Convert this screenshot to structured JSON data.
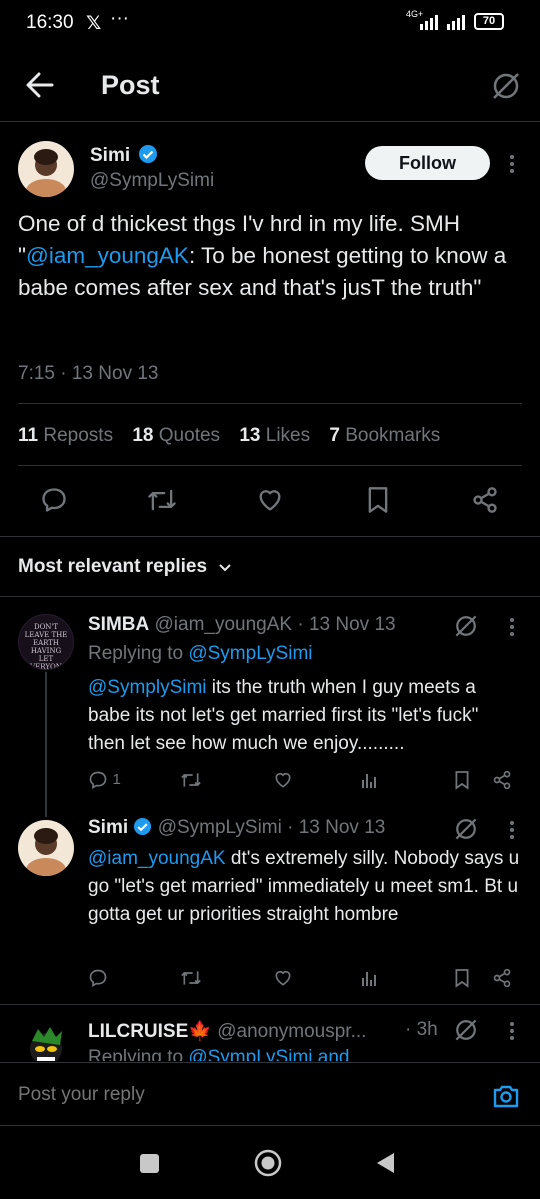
{
  "status_bar": {
    "time": "16:30",
    "x_logo": "𝕏",
    "dots": "···",
    "network": "4G+",
    "battery": "70"
  },
  "header": {
    "title": "Post"
  },
  "post": {
    "author_name": "Simi",
    "handle": "@SympLySimi",
    "follow_label": "Follow",
    "text_prefix": "One of d thickest thgs I'v hrd in my life. SMH \"",
    "mention": "@iam_youngAK",
    "text_suffix": ": To be honest getting to know a babe comes after sex and that's jusT the truth\"",
    "timestamp": "7:15 · 13 Nov 13",
    "stats": {
      "reposts_count": "11",
      "reposts_label": "Reposts",
      "quotes_count": "18",
      "quotes_label": "Quotes",
      "likes_count": "13",
      "likes_label": "Likes",
      "bookmarks_count": "7",
      "bookmarks_label": "Bookmarks"
    }
  },
  "replies_header": "Most relevant replies",
  "replies": [
    {
      "name": "SIMBA",
      "handle_time": "@iam_youngAK · 13 Nov 13",
      "replying_prefix": "Replying to ",
      "replying_to": "@SympLySimi",
      "mention": "@SymplySimi",
      "text": " its the truth when I guy meets a babe its not let's get married first its \"let's fuck\" then let see how much we enjoy.........",
      "reply_count": "1",
      "avatar_text": "DON'T LEAVE THE EARTH HAVING LET EVERYONE ELSE USE YOU BUT GOD"
    },
    {
      "name": "Simi",
      "handle_time": "@SympLySimi · 13 Nov 13",
      "mention": "@iam_youngAK",
      "text": " dt's extremely silly. Nobody says u go \"let's get married\" immediately u meet sm1. Bt u gotta get ur priorities straight hombre"
    },
    {
      "name": "LILCRUISE🍁",
      "handle": "@anonymouspr...",
      "time": "· 3h",
      "replying_prefix": "Replying to ",
      "replying_to": "@SympLySimi and"
    }
  ],
  "reply_bar": {
    "placeholder": "Post your reply"
  },
  "colors": {
    "accent": "#1d9bf0",
    "background": "#000000",
    "muted": "#71767b",
    "divider": "#2f3336"
  },
  "icons": [
    "back-arrow-icon",
    "grok-icon",
    "verified-badge-icon",
    "more-icon",
    "reply-icon",
    "repost-icon",
    "like-icon",
    "bookmark-icon",
    "share-icon",
    "views-icon",
    "chevron-down-icon",
    "camera-icon"
  ]
}
